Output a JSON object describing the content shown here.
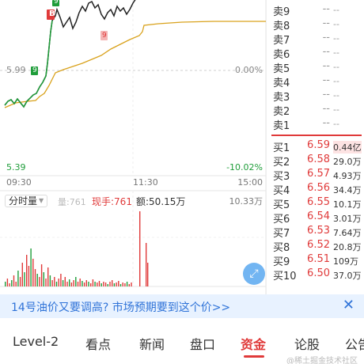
{
  "chart": {
    "price_low": "5.39",
    "pct_low": "-10.02%",
    "price_mid": "5.99",
    "pct_mid": "0.00%",
    "time_open": "09:30",
    "time_mid": "11:30",
    "time_close": "15:00",
    "marker_b": "B",
    "marker_9a": "9",
    "marker_9b": "9",
    "marker_9c": "9"
  },
  "volume_bar": {
    "time_share_label": "分时量",
    "vol_text": "量:761",
    "current_hand": "现手:761",
    "amount": "额:50.15万",
    "max_vol": "10.33万"
  },
  "order_book": {
    "sell": [
      {
        "label": "卖9",
        "price": "--",
        "volume": "--"
      },
      {
        "label": "卖8",
        "price": "--",
        "volume": "--"
      },
      {
        "label": "卖7",
        "price": "--",
        "volume": "--"
      },
      {
        "label": "卖6",
        "price": "--",
        "volume": "--"
      },
      {
        "label": "卖5",
        "price": "--",
        "volume": "--"
      },
      {
        "label": "卖4",
        "price": "--",
        "volume": "--"
      },
      {
        "label": "卖3",
        "price": "--",
        "volume": "--"
      },
      {
        "label": "卖2",
        "price": "--",
        "volume": "--"
      },
      {
        "label": "卖1",
        "price": "--",
        "volume": "--"
      }
    ],
    "buy": [
      {
        "label": "买1",
        "price": "6.59",
        "volume": "0.44亿"
      },
      {
        "label": "买2",
        "price": "6.58",
        "volume": "29.0万"
      },
      {
        "label": "买3",
        "price": "6.57",
        "volume": "4.93万"
      },
      {
        "label": "买4",
        "price": "6.56",
        "volume": "34.4万"
      },
      {
        "label": "买5",
        "price": "6.55",
        "volume": "10.1万"
      },
      {
        "label": "买6",
        "price": "6.54",
        "volume": "3.01万"
      },
      {
        "label": "买7",
        "price": "6.53",
        "volume": "7.64万"
      },
      {
        "label": "买8",
        "price": "6.52",
        "volume": "20.8万"
      },
      {
        "label": "买9",
        "price": "6.51",
        "volume": "109万"
      },
      {
        "label": "买10",
        "price": "6.50",
        "volume": "37.0万"
      }
    ]
  },
  "banner": {
    "text": "14号油价又要调高? 市场预期要到这个价>>",
    "close_icon": "close-icon"
  },
  "tabs": [
    {
      "label": "Level-2"
    },
    {
      "label": "看点"
    },
    {
      "label": "新闻"
    },
    {
      "label": "盘口"
    },
    {
      "label": "资金"
    },
    {
      "label": "论股"
    },
    {
      "label": "公告"
    }
  ],
  "active_tab": "资金",
  "watermark": "@稀土掘金技术社区",
  "colors": {
    "up": "#e03a3a",
    "down": "#1f9d3a",
    "avg_line": "#d9a21c",
    "link": "#2f73d8"
  }
}
